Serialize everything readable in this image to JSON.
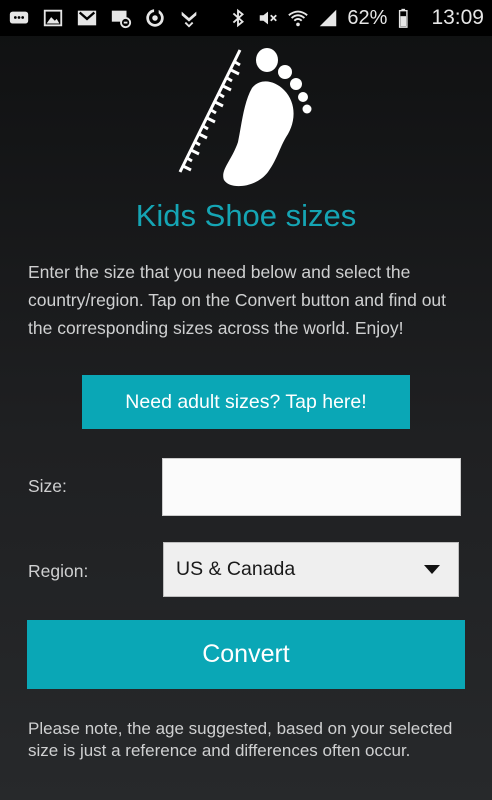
{
  "status_bar": {
    "battery_percent": "62%",
    "time": "13:09",
    "icons": [
      "chat-icon",
      "gallery-icon",
      "gmail-icon",
      "voicemail-icon",
      "sync-icon",
      "check-icon",
      "bluetooth-icon",
      "mute-icon",
      "wifi-icon",
      "signal-icon",
      "battery-icon"
    ]
  },
  "header": {
    "logo_icon": "footprint-ruler-icon",
    "title": "Kids Shoe sizes"
  },
  "intro_text": "Enter the size that you need below and select the country/region. Tap on the Convert button and find out the corresponding sizes across the world. Enjoy!",
  "adult_button_label": "Need adult sizes? Tap here!",
  "form": {
    "size_label": "Size:",
    "size_value": "",
    "region_label": "Region:",
    "region_value": "US & Canada"
  },
  "convert_label": "Convert",
  "note_text": "Please note, the age suggested, based on your selected size is just a reference and differences often occur.",
  "colors": {
    "accent": "#0aa7b6",
    "title": "#15a5b4",
    "background": "#1f2022"
  }
}
